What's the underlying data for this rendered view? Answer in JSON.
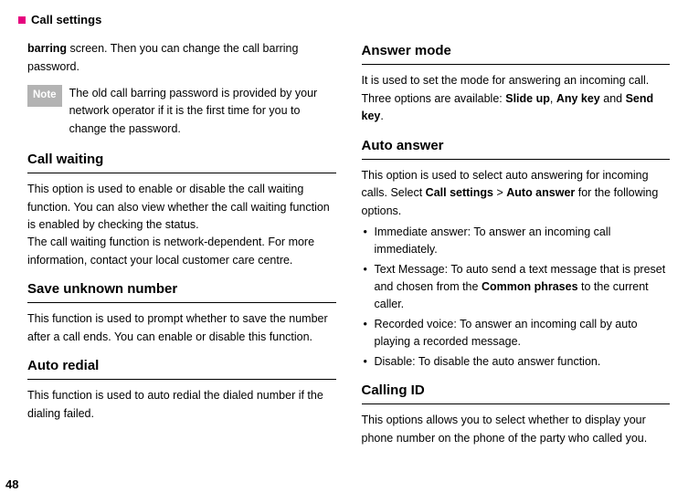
{
  "header": {
    "title": "Call settings"
  },
  "col1": {
    "intro_html": "<span class='bold'>barring</span> screen. Then you can change the call barring password.",
    "note_label": "Note",
    "note_text": "The old call barring password is provided by your network operator if it is the first time for you to change the password.",
    "sec1_heading": "Call waiting",
    "sec1_p1": "This option is used to enable or disable the call waiting function. You can also view whether the call waiting function is enabled by checking the status.",
    "sec1_p2": "The call waiting function is network-dependent. For more information, contact your local customer care centre.",
    "sec2_heading": "Save unknown number",
    "sec2_p1": "This function is used to prompt whether to save the number after a call ends. You can enable or disable this function.",
    "sec3_heading": "Auto redial",
    "sec3_p1": "This function is used to auto redial the dialed number if the dialing failed."
  },
  "col2": {
    "sec1_heading": "Answer mode",
    "sec1_p1_html": "It is used to set the mode for answering an incoming call. Three options are available: <span class='bold'>Slide up</span>, <span class='bold'>Any key</span> and <span class='bold'>Send key</span>.",
    "sec2_heading": "Auto answer",
    "sec2_p1_html": "This option is used to select auto answering for incoming calls. Select <span class='bold'>Call settings</span> &gt; <span class='bold'>Auto answer</span> for the following options.",
    "bullets": [
      "Immediate answer: To answer an incoming call immediately.",
      "",
      "Recorded voice: To answer an incoming call by auto playing a recorded message.",
      "Disable: To disable the auto answer function."
    ],
    "bullet2_html": "Text Message: To auto send a text message that is preset and chosen from the <span class='bold'>Common phrases</span> to the current caller.",
    "sec3_heading": "Calling ID",
    "sec3_p1": "This options allows you to select whether to display your phone number on the phone of the party who called you."
  },
  "page_number": "48"
}
